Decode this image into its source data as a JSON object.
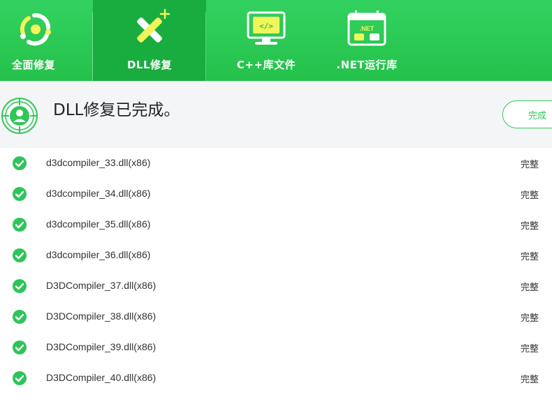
{
  "nav": {
    "tabs": [
      {
        "label": "全面修复",
        "icon": "full-repair-icon",
        "active": false
      },
      {
        "label": "DLL修复",
        "icon": "dll-repair-icon",
        "active": true
      },
      {
        "label": "C++库文件",
        "icon": "cpp-library-icon",
        "active": false
      },
      {
        "label": ".NET运行库",
        "icon": "dotnet-runtime-icon",
        "active": false
      }
    ],
    "net_badge": ".NET",
    "code_badge": "</>"
  },
  "banner": {
    "message": "DLL修复已完成。",
    "done_button": "完成"
  },
  "items": [
    {
      "name": "d3dcompiler_33.dll(x86)",
      "status": "完整"
    },
    {
      "name": "d3dcompiler_34.dll(x86)",
      "status": "完整"
    },
    {
      "name": "d3dcompiler_35.dll(x86)",
      "status": "完整"
    },
    {
      "name": "d3dcompiler_36.dll(x86)",
      "status": "完整"
    },
    {
      "name": "D3DCompiler_37.dll(x86)",
      "status": "完整"
    },
    {
      "name": "D3DCompiler_38.dll(x86)",
      "status": "完整"
    },
    {
      "name": "D3DCompiler_39.dll(x86)",
      "status": "完整"
    },
    {
      "name": "D3DCompiler_40.dll(x86)",
      "status": "完整"
    }
  ],
  "colors": {
    "brand_green": "#2fc757",
    "nav_active": "#19ad3f",
    "check_green": "#2ec45a"
  }
}
